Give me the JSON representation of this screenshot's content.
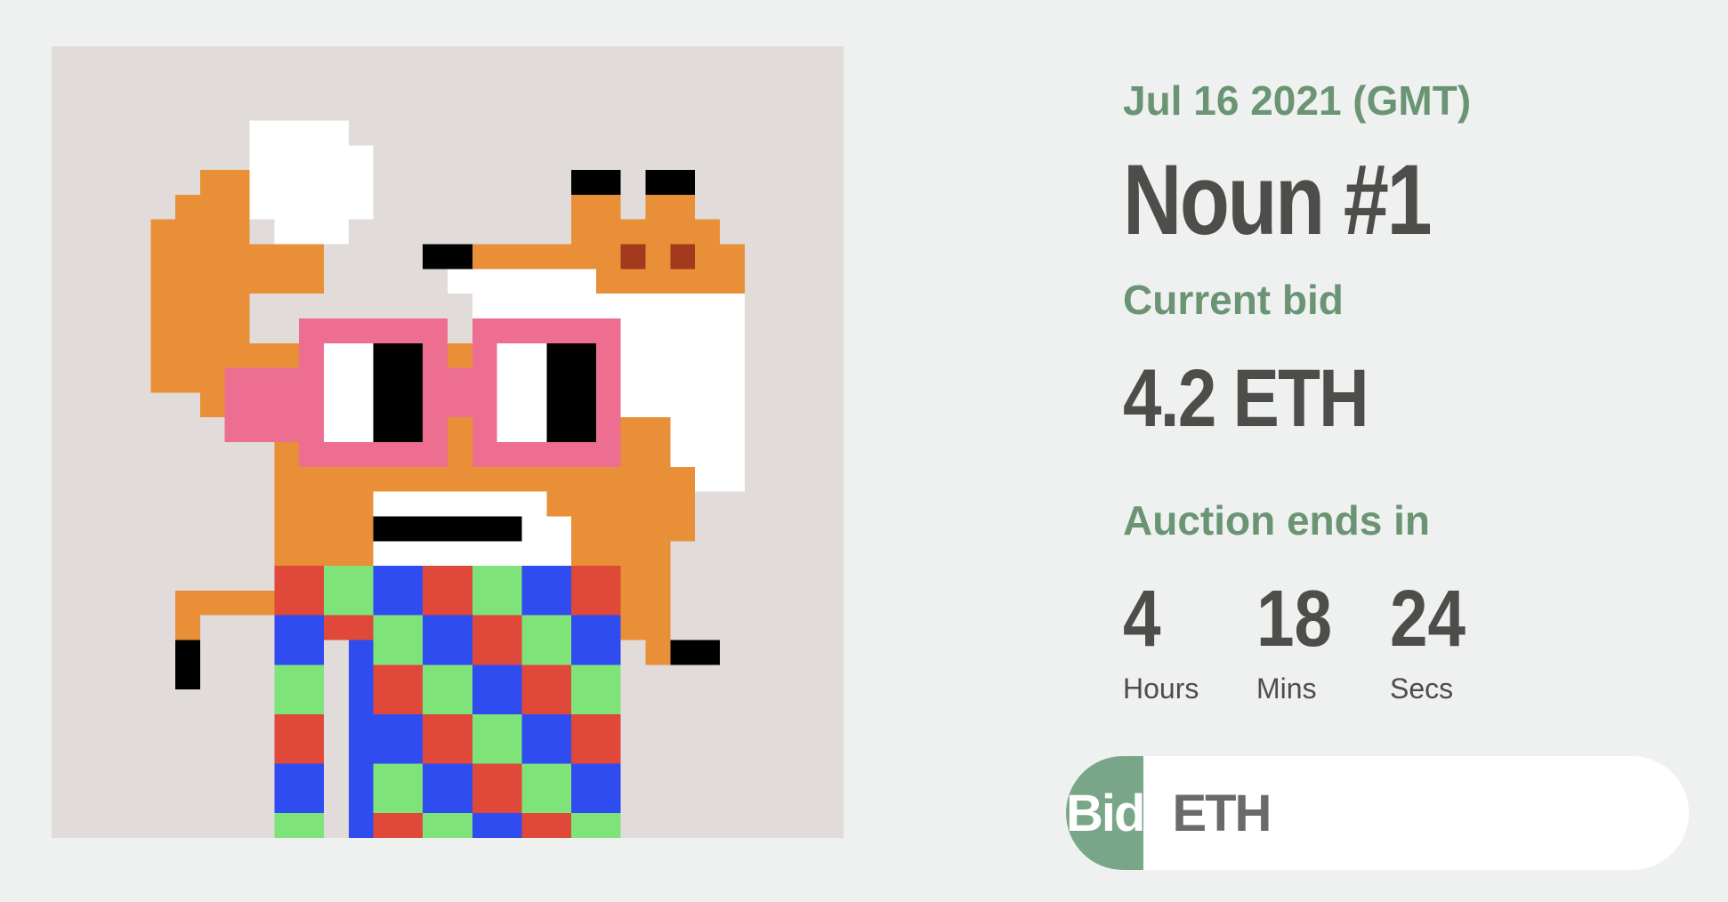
{
  "auction": {
    "date": "Jul 16 2021 (GMT)",
    "title": "Noun #1",
    "current_bid_label": "Current bid",
    "current_bid_value": "4.2 ETH",
    "ends_label": "Auction ends in",
    "timer": [
      {
        "value": "4",
        "label": "Hours"
      },
      {
        "value": "18",
        "label": "Mins"
      },
      {
        "value": "24",
        "label": "Secs"
      }
    ]
  },
  "bid_form": {
    "button_label": "Bid",
    "input_placeholder": "ETH"
  },
  "artwork": {
    "icon": "noun-pixel-art",
    "colors": {
      "background": "#e1dbd9",
      "orange": "#e88f37",
      "pink": "#ed6e91",
      "red": "#e0483a",
      "green": "#7ee47a",
      "blue": "#2f4cf0",
      "white": "#ffffff",
      "black": "#000000",
      "brown": "#a3391d"
    }
  }
}
